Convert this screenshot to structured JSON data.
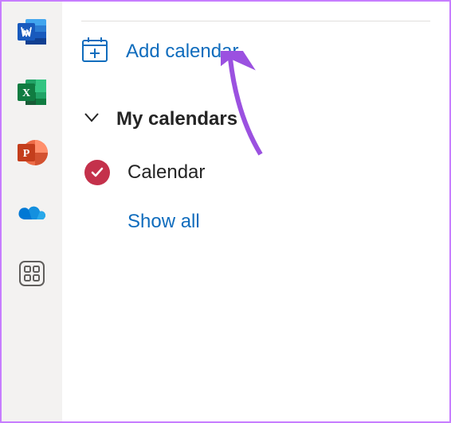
{
  "rail": {
    "apps": [
      "word",
      "excel",
      "powerpoint",
      "onedrive",
      "apps"
    ]
  },
  "sidebar": {
    "add_calendar_label": "Add calendar",
    "section_title": "My calendars",
    "calendars": [
      {
        "name": "Calendar",
        "color": "#c4314b",
        "checked": true
      }
    ],
    "show_all_label": "Show all"
  }
}
